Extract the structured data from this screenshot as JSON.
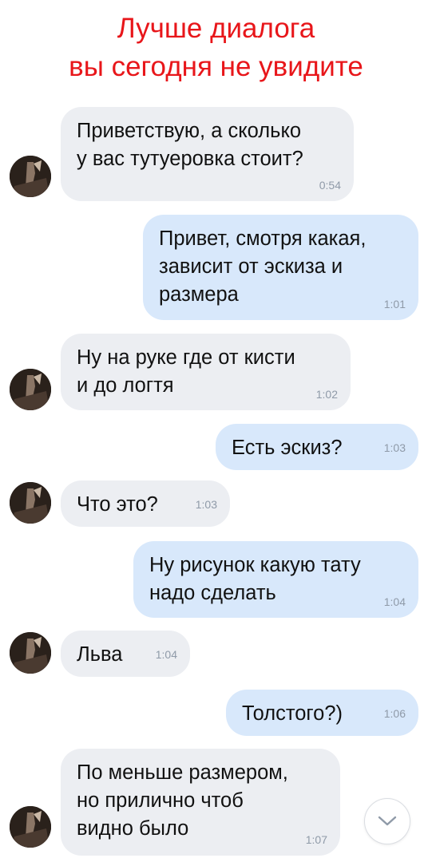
{
  "header": {
    "line1": "Лучше диалога",
    "line2": "вы сегодня не увидите"
  },
  "messages": [
    {
      "side": "in",
      "text": "Приветствую, а сколько\nу вас тутуеровка стоит?",
      "time": "0:54"
    },
    {
      "side": "out",
      "text": "Привет, смотря какая,\nзависит от эскиза и\nразмера",
      "time": "1:01"
    },
    {
      "side": "in",
      "text": "Ну на руке где от кисти\nи до логтя",
      "time": "1:02"
    },
    {
      "side": "out",
      "text": "Есть эскиз?",
      "time": "1:03"
    },
    {
      "side": "in",
      "text": "Что это?",
      "time": "1:03"
    },
    {
      "side": "out",
      "text": "Ну рисунок какую тату\nнадо сделать",
      "time": "1:04"
    },
    {
      "side": "in",
      "text": "Льва",
      "time": "1:04"
    },
    {
      "side": "out",
      "text": "Толстого?)",
      "time": "1:06"
    },
    {
      "side": "in",
      "text": "По меньше размером,\nно прилично чтоб\nвидно было",
      "time": "1:07"
    }
  ],
  "icons": {
    "avatar": "user-avatar-photo",
    "scroll": "chevron-down-icon"
  },
  "colors": {
    "title": "#e8161a",
    "incoming_bubble": "#eceef2",
    "outgoing_bubble": "#d8e8fb",
    "time": "#8f9aa8"
  }
}
